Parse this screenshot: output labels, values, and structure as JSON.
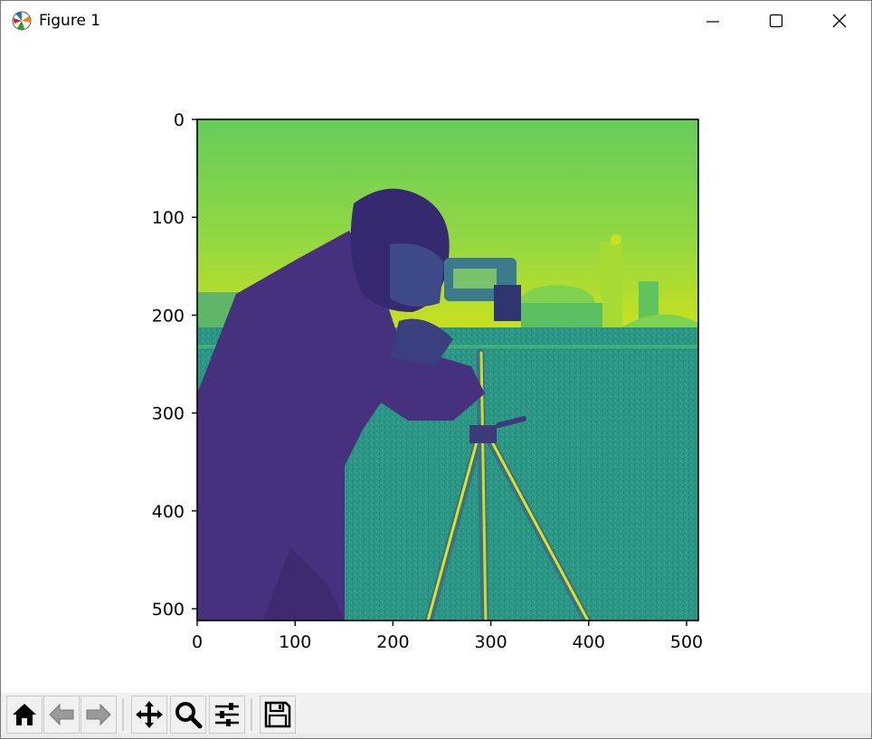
{
  "window": {
    "title": "Figure 1",
    "controls": [
      "minimize",
      "maximize",
      "close"
    ]
  },
  "toolbar": {
    "buttons": [
      {
        "icon": "home-icon",
        "tooltip": "Home"
      },
      {
        "icon": "back-arrow-icon",
        "tooltip": "Back"
      },
      {
        "icon": "forward-arrow-icon",
        "tooltip": "Forward"
      },
      {
        "icon": "pan-move-icon",
        "tooltip": "Pan"
      },
      {
        "icon": "zoom-magnifier-icon",
        "tooltip": "Zoom"
      },
      {
        "icon": "configure-subplots-icon",
        "tooltip": "Subplots"
      },
      {
        "icon": "save-floppy-icon",
        "tooltip": "Save"
      }
    ]
  },
  "chart_data": {
    "type": "heatmap",
    "image": "cameraman photograph rendered with viridis colormap",
    "colormap": "viridis",
    "x_ticks": [
      0,
      100,
      200,
      300,
      400,
      500
    ],
    "y_ticks": [
      0,
      100,
      200,
      300,
      400,
      500
    ],
    "xlim": [
      0,
      512
    ],
    "ylim": [
      512,
      0
    ],
    "title": "",
    "xlabel": "",
    "ylabel": ""
  },
  "colors": {
    "viridis_dark": "#3b1f5f",
    "viridis_purple": "#46327e",
    "viridis_teal": "#2c8c8a",
    "viridis_green": "#5ec962",
    "viridis_yellow": "#cfe11c"
  }
}
